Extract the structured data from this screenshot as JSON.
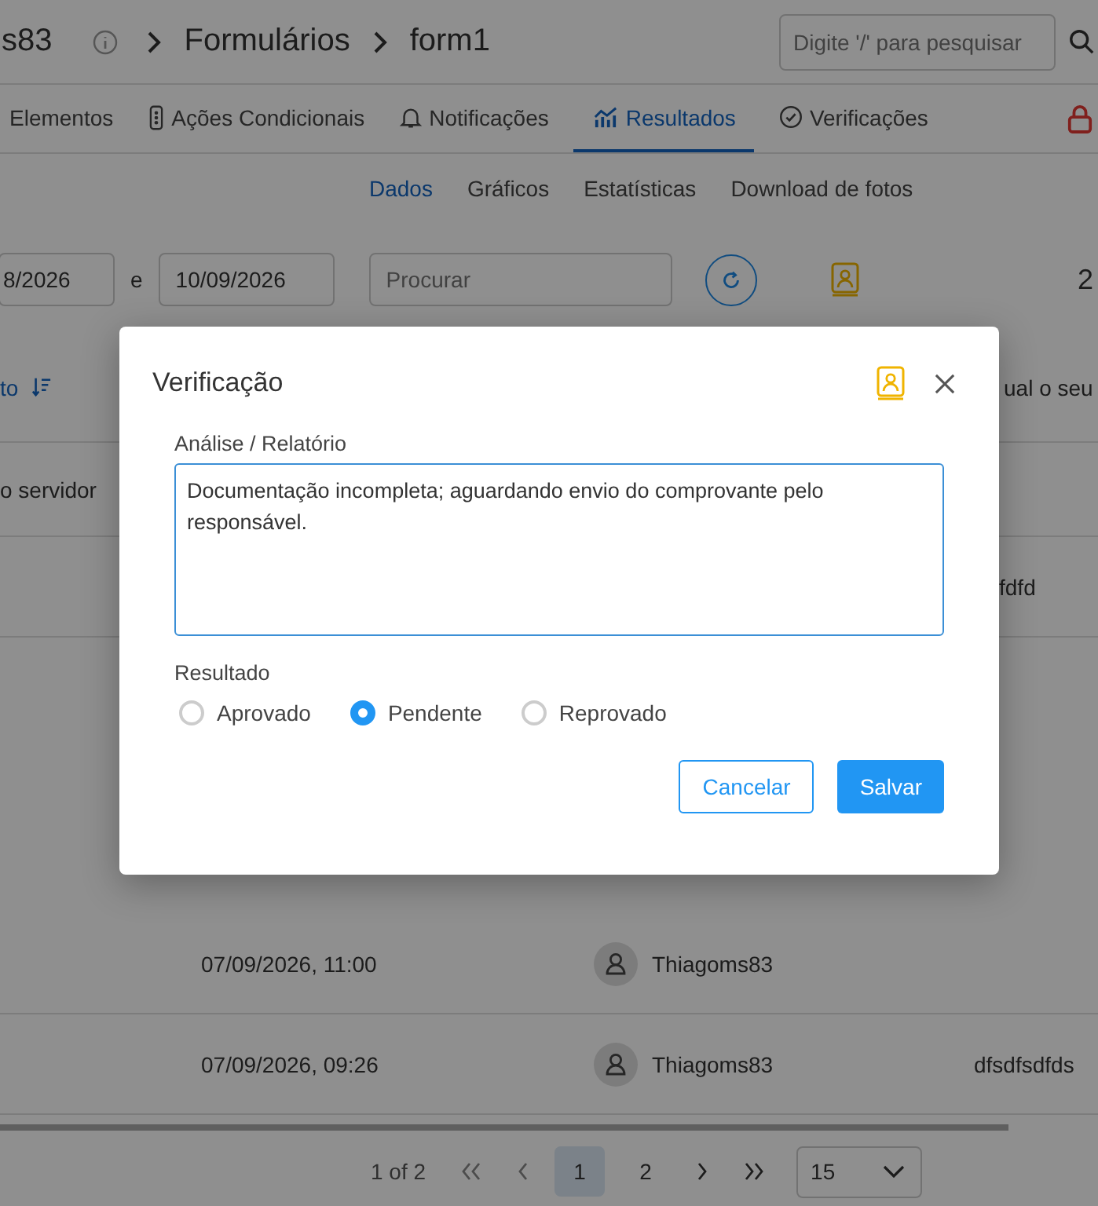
{
  "header": {
    "breadcrumb": [
      "s83",
      "Formulários",
      "form1"
    ],
    "search_placeholder": "Digite '/' para pesquisar"
  },
  "tabs": [
    {
      "label": "Elementos",
      "kind": "plain",
      "selected": false
    },
    {
      "label": "Ações Condicionais",
      "kind": "traffic",
      "selected": false
    },
    {
      "label": "Notificações",
      "kind": "bell",
      "selected": false
    },
    {
      "label": "Resultados",
      "kind": "chart",
      "selected": true
    },
    {
      "label": "Verificações",
      "kind": "check",
      "selected": false
    }
  ],
  "subtabs": [
    {
      "label": "Dados",
      "selected": true
    },
    {
      "label": "Gráficos",
      "selected": false
    },
    {
      "label": "Estatísticas",
      "selected": false
    },
    {
      "label": "Download de fotos",
      "selected": false
    }
  ],
  "filters": {
    "date_from": "8/2026",
    "between": "e",
    "date_to": "10/09/2026",
    "search_placeholder": "Procurar",
    "count": "2"
  },
  "table": {
    "sort_header": "to",
    "right_header": "ual o seu",
    "subheader": "o servidor",
    "rows": [
      {
        "note": "fdfd"
      },
      {
        "date": "07/09/2026, 11:00",
        "user": "Thiagoms83"
      },
      {
        "date": "07/09/2026, 09:26",
        "user": "Thiagoms83",
        "note": "dfsdfsdfds"
      }
    ]
  },
  "pagination": {
    "summary": "1 of 2",
    "pages": [
      {
        "label": "1",
        "selected": true
      },
      {
        "label": "2",
        "selected": false
      }
    ],
    "page_size": "15"
  },
  "dialog": {
    "title": "Verificação",
    "field_label": "Análise / Relatório",
    "value": "Documentação incompleta; aguardando envio do comprovante pelo responsável.",
    "result_label": "Resultado",
    "options": [
      {
        "label": "Aprovado",
        "selected": false
      },
      {
        "label": "Pendente",
        "selected": true
      },
      {
        "label": "Reprovado",
        "selected": false
      }
    ],
    "buttons": [
      {
        "label": "Cancelar",
        "kind": "secondary"
      },
      {
        "label": "Salvar",
        "kind": "primary"
      }
    ]
  }
}
